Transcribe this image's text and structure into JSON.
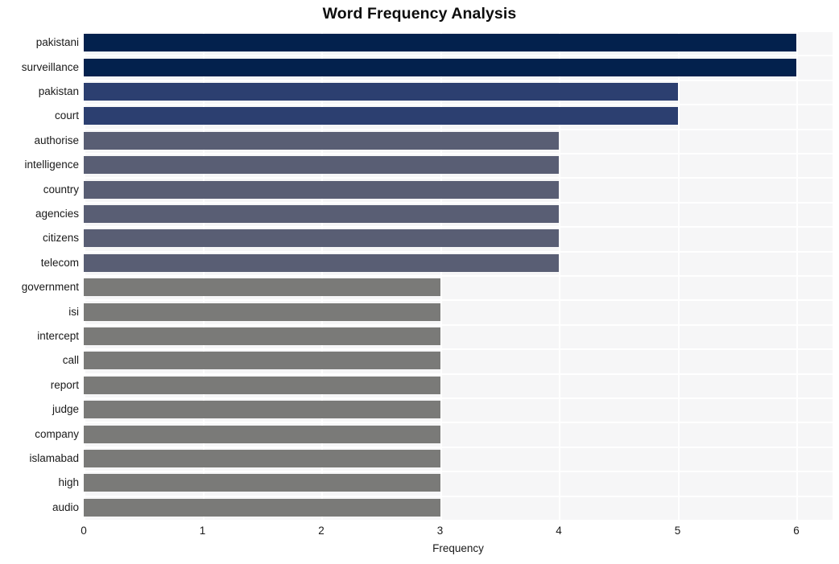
{
  "chart_data": {
    "type": "bar",
    "orientation": "horizontal",
    "title": "Word Frequency Analysis",
    "xlabel": "Frequency",
    "ylabel": "",
    "xlim": [
      0,
      6
    ],
    "xticks": [
      "0",
      "1",
      "2",
      "3",
      "4",
      "5",
      "6"
    ],
    "grid": true,
    "legend": "none",
    "categories": [
      "pakistani",
      "surveillance",
      "pakistan",
      "court",
      "authorise",
      "intelligence",
      "country",
      "agencies",
      "citizens",
      "telecom",
      "government",
      "isi",
      "intercept",
      "call",
      "report",
      "judge",
      "company",
      "islamabad",
      "high",
      "audio"
    ],
    "values": [
      6,
      6,
      5,
      5,
      4,
      4,
      4,
      4,
      4,
      4,
      3,
      3,
      3,
      3,
      3,
      3,
      3,
      3,
      3,
      3
    ],
    "bar_colors": [
      "#03214d",
      "#03214d",
      "#2c3f70",
      "#2c3f70",
      "#595e74",
      "#595e74",
      "#595e74",
      "#595e74",
      "#595e74",
      "#595e74",
      "#7a7a78",
      "#7a7a78",
      "#7a7a78",
      "#7a7a78",
      "#7a7a78",
      "#7a7a78",
      "#7a7a78",
      "#7a7a78",
      "#7a7a78",
      "#7a7a78"
    ],
    "palette": {
      "darkest": "#03214d",
      "dark": "#2c3f70",
      "mid": "#595e74",
      "light": "#7a7a78",
      "plot_background": "#f6f6f7",
      "gridline": "#ffffff",
      "figure_background": "#ffffff",
      "text": "#1a1a1a"
    }
  }
}
